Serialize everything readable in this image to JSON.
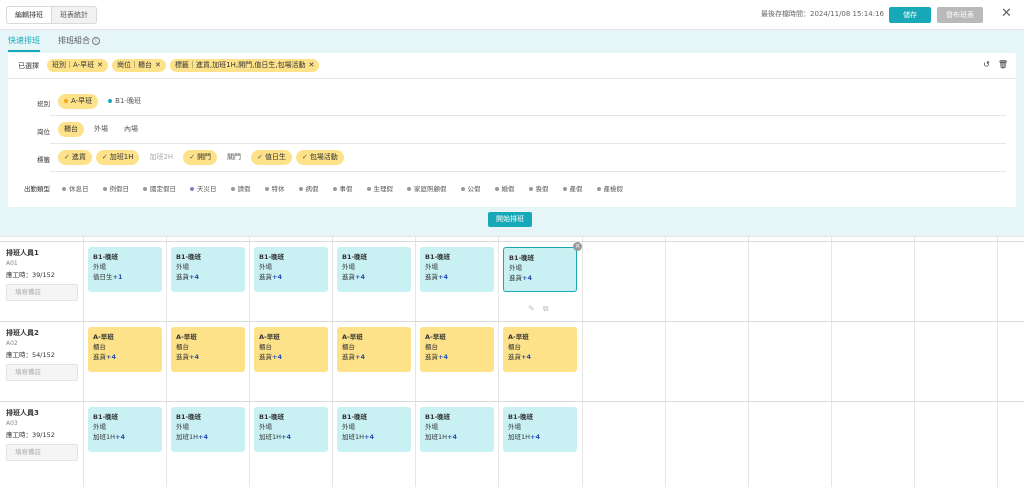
{
  "header": {
    "segments": [
      "編輯排班",
      "班表統計"
    ],
    "saved_at": "最後存檔時間：2024/11/08 15:14:16",
    "save_label": "儲存",
    "publish_label": "發布班表",
    "close": "✕"
  },
  "tabs": [
    {
      "label": "快速排班"
    },
    {
      "label": "排班組合"
    }
  ],
  "info_icon": "ⓘ",
  "selected": {
    "label": "已選擇",
    "chips": [
      "班別｜A-早班",
      "崗位｜櫃台",
      "標籤｜進貨,加班1H,開門,值日生,包場活動"
    ],
    "reset_icon": "↺",
    "delete_icon": "🗑"
  },
  "filters": {
    "shift": {
      "label": "班別",
      "options": [
        {
          "label": "A-早班",
          "color": "#f5a623",
          "on": true
        },
        {
          "label": "B1-晚班",
          "color": "#17a9b8",
          "on": false
        }
      ]
    },
    "post": {
      "label": "崗位",
      "options": [
        {
          "label": "櫃台",
          "on": true
        },
        {
          "label": "外場",
          "on": false
        },
        {
          "label": "內場",
          "on": false
        }
      ]
    },
    "tags": {
      "label": "標籤",
      "options": [
        {
          "label": "進貨",
          "on": true
        },
        {
          "label": "加班1H",
          "on": true
        },
        {
          "label": "加班2H",
          "on": false,
          "muted": true
        },
        {
          "label": "開門",
          "on": true
        },
        {
          "label": "關門",
          "on": false
        },
        {
          "label": "值日生",
          "on": true
        },
        {
          "label": "包場活動",
          "on": true
        }
      ]
    },
    "attendance": {
      "label": "出勤類型",
      "options": [
        {
          "label": "休息日",
          "color": "#999999"
        },
        {
          "label": "例假日",
          "color": "#999999"
        },
        {
          "label": "國定假日",
          "color": "#999999"
        },
        {
          "label": "天災日",
          "color": "#8e7cc3"
        },
        {
          "label": "請假",
          "color": "#999999"
        },
        {
          "label": "特休",
          "color": "#999999"
        },
        {
          "label": "病假",
          "color": "#999999"
        },
        {
          "label": "事假",
          "color": "#999999"
        },
        {
          "label": "生理假",
          "color": "#999999"
        },
        {
          "label": "家庭照顧假",
          "color": "#999999"
        },
        {
          "label": "公假",
          "color": "#999999"
        },
        {
          "label": "婚假",
          "color": "#999999"
        },
        {
          "label": "喪假",
          "color": "#999999"
        },
        {
          "label": "產假",
          "color": "#999999"
        },
        {
          "label": "產檢假",
          "color": "#999999"
        }
      ]
    }
  },
  "start_label": "開始排班",
  "note_placeholder": "填寫備註",
  "staff": [
    {
      "name": "排班人員1",
      "id": "A01",
      "hours": "應工時：39/152",
      "shifts": [
        {
          "title": "B1-晚班",
          "post": "外場",
          "tag": "值日生",
          "more": "+1",
          "color": "teal"
        },
        {
          "title": "B1-晚班",
          "post": "外場",
          "tag": "進貨",
          "more": "+4",
          "color": "teal"
        },
        {
          "title": "B1-晚班",
          "post": "外場",
          "tag": "進貨",
          "more": "+4",
          "color": "teal"
        },
        {
          "title": "B1-晚班",
          "post": "外場",
          "tag": "進貨",
          "more": "+4",
          "color": "teal"
        },
        {
          "title": "B1-晚班",
          "post": "外場",
          "tag": "進貨",
          "more": "+4",
          "color": "teal"
        },
        {
          "title": "B1-晚班",
          "post": "外場",
          "tag": "進貨",
          "more": "+4",
          "color": "selected"
        }
      ]
    },
    {
      "name": "排班人員2",
      "id": "A02",
      "hours": "應工時：54/152",
      "shifts": [
        {
          "title": "A-早班",
          "post": "櫃台",
          "tag": "進貨",
          "more": "+4",
          "color": "yellow"
        },
        {
          "title": "A-早班",
          "post": "櫃台",
          "tag": "進貨",
          "more": "+4",
          "color": "yellow"
        },
        {
          "title": "A-早班",
          "post": "櫃台",
          "tag": "進貨",
          "more": "+4",
          "color": "yellow"
        },
        {
          "title": "A-早班",
          "post": "櫃台",
          "tag": "進貨",
          "more": "+4",
          "color": "yellow"
        },
        {
          "title": "A-早班",
          "post": "櫃台",
          "tag": "進貨",
          "more": "+4",
          "color": "yellow"
        },
        {
          "title": "A-早班",
          "post": "櫃台",
          "tag": "進貨",
          "more": "+4",
          "color": "yellow"
        }
      ]
    },
    {
      "name": "排班人員3",
      "id": "A03",
      "hours": "應工時：39/152",
      "shifts": [
        {
          "title": "B1-晚班",
          "post": "外場",
          "tag": "加班1H",
          "more": "+4",
          "color": "teal"
        },
        {
          "title": "B1-晚班",
          "post": "外場",
          "tag": "加班1H",
          "more": "+4",
          "color": "teal"
        },
        {
          "title": "B1-晚班",
          "post": "外場",
          "tag": "加班1H",
          "more": "+4",
          "color": "teal"
        },
        {
          "title": "B1-晚班",
          "post": "外場",
          "tag": "加班1H",
          "more": "+4",
          "color": "teal"
        },
        {
          "title": "B1-晚班",
          "post": "外場",
          "tag": "加班1H",
          "more": "+4",
          "color": "teal"
        },
        {
          "title": "B1-晚班",
          "post": "外場",
          "tag": "加班1H",
          "more": "+4",
          "color": "teal"
        }
      ]
    }
  ],
  "remove_icon": "×",
  "edit_icon": "✎",
  "copy_icon": "⧉"
}
